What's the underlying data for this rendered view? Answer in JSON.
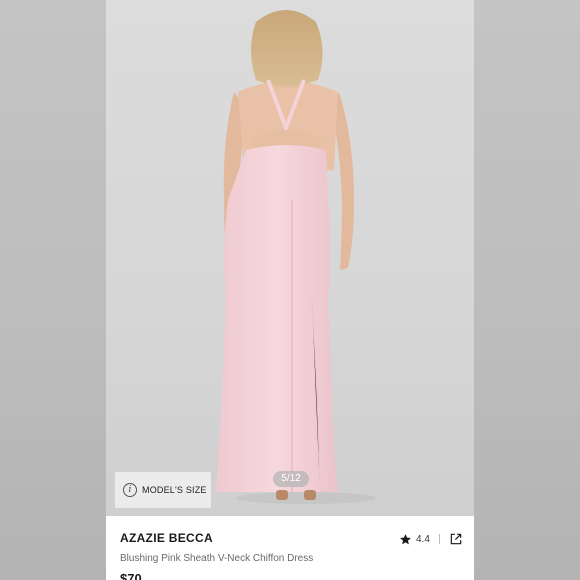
{
  "listing": {
    "brand": "AZAZIE BECCA",
    "product_name": "Blushing Pink Sheath V-Neck Chiffon Dress",
    "price": "$70",
    "rating": "4.4",
    "image_counter": "5/12",
    "model_size_label": "MODEL'S SIZE"
  },
  "icons": {
    "info": "info-icon",
    "rating": "star-icon",
    "share": "share-external-icon"
  },
  "colors": {
    "dress": "#f4d3d9",
    "background": "#d8d8d8",
    "brand_text": "#1a1a1a"
  }
}
